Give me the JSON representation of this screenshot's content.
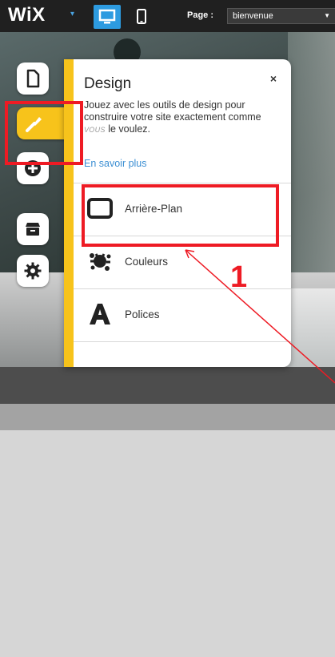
{
  "topbar": {
    "logo": "WiX",
    "page_label": "Page :",
    "page_value": "bienvenue"
  },
  "panel": {
    "title": "Design",
    "close": "×",
    "description_part1": "Jouez avec les outils de design pour construire votre site exactement comme ",
    "description_emph": "VOUS",
    "description_part2": " le voulez.",
    "learn_more": "En savoir plus",
    "items": [
      {
        "label": "Arrière-Plan",
        "icon": "background-icon"
      },
      {
        "label": "Couleurs",
        "icon": "paint-splash-icon"
      },
      {
        "label": "Polices",
        "icon": "font-icon"
      }
    ]
  },
  "sidebar": {
    "tools": [
      {
        "name": "pages",
        "icon": "page-icon"
      },
      {
        "name": "design",
        "icon": "paintbrush-icon",
        "active": true
      },
      {
        "name": "add",
        "icon": "plus-icon"
      },
      {
        "name": "app-market",
        "icon": "store-icon"
      },
      {
        "name": "settings",
        "icon": "gear-icon"
      }
    ]
  },
  "annotation": {
    "step_number": "1",
    "color": "#ee1b24"
  },
  "colors": {
    "accent_yellow": "#f7c31b",
    "accent_blue": "#2d9be0",
    "link_blue": "#3c8fd3"
  }
}
